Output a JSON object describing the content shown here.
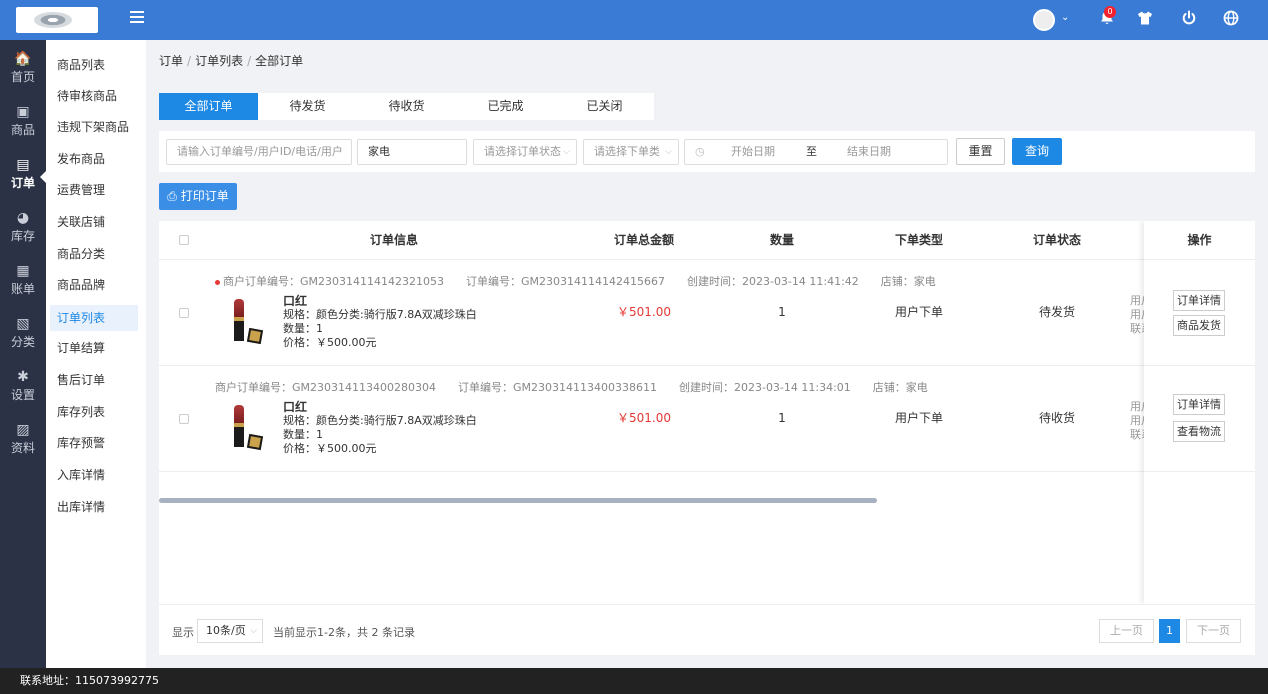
{
  "topbar": {
    "icons": [
      "menu-icon",
      "bell-icon",
      "shirt-icon",
      "power-icon",
      "globe-icon"
    ],
    "notification_count": "0"
  },
  "iconnav": [
    {
      "label": "首页",
      "icon": "home-icon",
      "glyph": "🏠"
    },
    {
      "label": "商品",
      "icon": "box-icon",
      "glyph": "▣"
    },
    {
      "label": "订单",
      "icon": "order-icon",
      "glyph": "▤"
    },
    {
      "label": "库存",
      "icon": "pie-icon",
      "glyph": "◕"
    },
    {
      "label": "账单",
      "icon": "bill-icon",
      "glyph": "▦"
    },
    {
      "label": "分类",
      "icon": "category-icon",
      "glyph": "▧"
    },
    {
      "label": "设置",
      "icon": "puzzle-icon",
      "glyph": "✱"
    },
    {
      "label": "资料",
      "icon": "image-icon",
      "glyph": "▨"
    }
  ],
  "subnav": [
    "商品列表",
    "待审核商品",
    "违规下架商品",
    "发布商品",
    "运费管理",
    "关联店铺",
    "商品分类",
    "商品品牌",
    "订单列表",
    "订单结算",
    "售后订单",
    "库存列表",
    "库存预警",
    "入库详情",
    "出库详情"
  ],
  "breadcrumb": [
    "订单",
    "订单列表",
    "全部订单"
  ],
  "tabs": [
    "全部订单",
    "待发货",
    "待收货",
    "已完成",
    "已关闭"
  ],
  "filters": {
    "search_placeholder": "请输入订单编号/用户ID/电话/用户",
    "shop_value": "家电",
    "status_placeholder": "请选择订单状态",
    "type_placeholder": "请选择下单类",
    "start_placeholder": "开始日期",
    "to": "至",
    "end_placeholder": "结束日期",
    "reset": "重置",
    "query": "查询"
  },
  "print_label": "打印订单",
  "table": {
    "headers": {
      "info": "订单信息",
      "total": "订单总金额",
      "qty": "数量",
      "type": "下单类型",
      "status": "订单状态",
      "ops": "操作"
    },
    "rows": [
      {
        "meta": "商户订单编号：GM230314114142321053　　订单编号：GM230314114142415667　　创建时间：2023-03-14 11:41:42　　店铺：家电",
        "name": "口红",
        "spec": "规格：颜色分类:骑行版7.8A双减珍珠白",
        "count": "数量：1",
        "price": "价格：￥500.00元",
        "total": "￥501.00",
        "qty": "1",
        "type": "用户下单",
        "status": "待发货",
        "clipped": [
          "用户",
          "用户",
          "联系"
        ],
        "op1": "订单详情",
        "op2": "商品发货"
      },
      {
        "meta": "商户订单编号：GM230314113400280304　　订单编号：GM230314113400338611　　创建时间：2023-03-14 11:34:01　　店铺：家电",
        "name": "口红",
        "spec": "规格：颜色分类:骑行版7.8A双减珍珠白",
        "count": "数量：1",
        "price": "价格：￥500.00元",
        "total": "￥501.00",
        "qty": "1",
        "type": "用户下单",
        "status": "待收货",
        "clipped": [
          "用户",
          "用户",
          "联系"
        ],
        "op1": "订单详情",
        "op2": "查看物流"
      }
    ]
  },
  "pager": {
    "show": "显示",
    "pagesize": "10条/页",
    "summary": "当前显示1-2条，共 2 条记录",
    "prev": "上一页",
    "current": "1",
    "next": "下一页"
  },
  "footer": "联系地址：115073992775"
}
